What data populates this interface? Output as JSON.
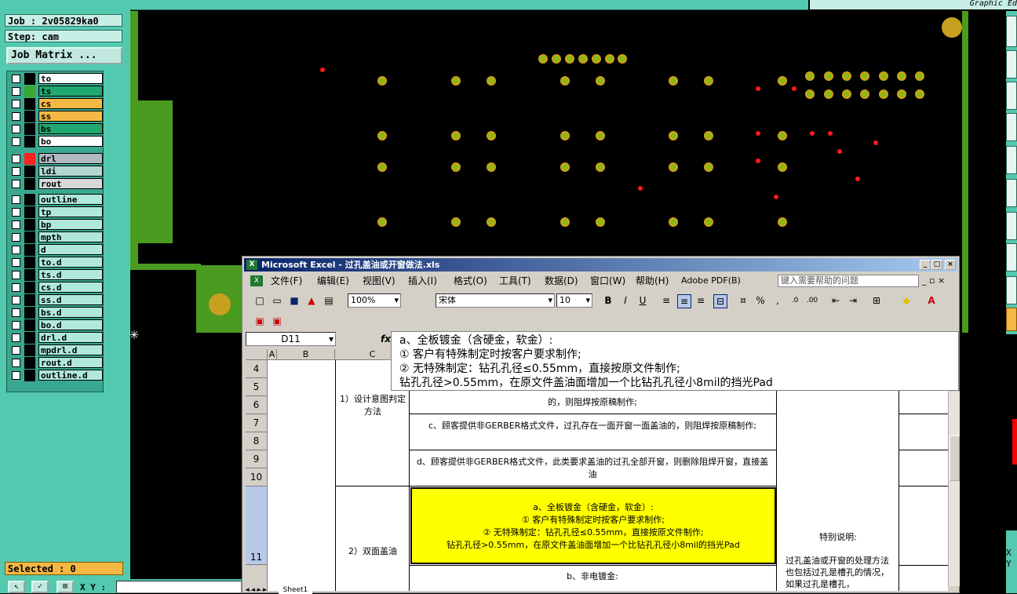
{
  "left_panel": {
    "job": "Job : 2v05829ka0",
    "step": "Step: cam",
    "job_matrix_button": "Job Matrix ...",
    "selected": "Selected : 0"
  },
  "layers": [
    {
      "name": "to",
      "color": "#ffffff",
      "swatch": "#000000"
    },
    {
      "name": "ts",
      "color": "#1fa870",
      "swatch": "#3aa830"
    },
    {
      "name": "cs",
      "color": "#f5b844",
      "swatch": "#000000"
    },
    {
      "name": "ss",
      "color": "#f5b844",
      "swatch": "#000000"
    },
    {
      "name": "bs",
      "color": "#1fa870",
      "swatch": "#000000"
    },
    {
      "name": "bo",
      "color": "#ffffff",
      "swatch": "#000000"
    },
    {
      "name": "drl",
      "color": "#b0b8c0",
      "swatch": "#ff2020"
    },
    {
      "name": "ldi",
      "color": "#b0d8d0",
      "swatch": "#000000"
    },
    {
      "name": "rout",
      "color": "#d8d8d8",
      "swatch": "#000000"
    },
    {
      "name": "outline",
      "color": "#b0e8dc",
      "swatch": "#000000"
    },
    {
      "name": "tp",
      "color": "#b0e8dc",
      "swatch": "#000000"
    },
    {
      "name": "bp",
      "color": "#b0e8dc",
      "swatch": "#000000"
    },
    {
      "name": "mpth",
      "color": "#b0e8dc",
      "swatch": "#000000"
    },
    {
      "name": "d",
      "color": "#b0e8dc",
      "swatch": "#000000"
    },
    {
      "name": "to.d",
      "color": "#b0e8dc",
      "swatch": "#000000"
    },
    {
      "name": "ts.d",
      "color": "#b0e8dc",
      "swatch": "#000000"
    },
    {
      "name": "cs.d",
      "color": "#b0e8dc",
      "swatch": "#000000"
    },
    {
      "name": "ss.d",
      "color": "#b0e8dc",
      "swatch": "#000000"
    },
    {
      "name": "bs.d",
      "color": "#b0e8dc",
      "swatch": "#000000"
    },
    {
      "name": "bo.d",
      "color": "#b0e8dc",
      "swatch": "#000000"
    },
    {
      "name": "drl.d",
      "color": "#b0e8dc",
      "swatch": "#000000"
    },
    {
      "name": "mpdrl.d",
      "color": "#b0e8dc",
      "swatch": "#000000"
    },
    {
      "name": "rout.d",
      "color": "#b0e8dc",
      "swatch": "#000000"
    },
    {
      "name": "outline.d",
      "color": "#b0e8dc",
      "swatch": "#000000"
    }
  ],
  "top_right_title": "Graphic Ed",
  "status_bar": {
    "xy_label": "X Y :",
    "right_x": "X",
    "right_y": "Y"
  },
  "excel": {
    "title": "Microsoft Excel - 过孔盖油或开窗做法.xls",
    "menu": [
      "文件(F)",
      "编辑(E)",
      "视图(V)",
      "插入(I)",
      "格式(O)",
      "工具(T)",
      "数据(D)",
      "窗口(W)",
      "帮助(H)",
      "Adobe PDF(B)"
    ],
    "help_placeholder": "键入需要帮助的问题",
    "zoom": "100%",
    "font": "宋体",
    "size": "10",
    "name_box": "D11",
    "fx": "fx",
    "formula_lines": [
      "a、全板镀金（含硬金，软金）:",
      "① 客户有特殊制定时按客户要求制作;",
      "② 无特殊制定：钻孔孔径≤0.55mm，直接按原文件制作;",
      "  钻孔孔径>0.55mm，在原文件盖油面增加一个比钻孔孔径小8mil的挡光Pad"
    ],
    "columns": [
      "A",
      "B",
      "C"
    ],
    "rows": [
      "4",
      "5",
      "6",
      "7",
      "8",
      "9",
      "10",
      "11"
    ],
    "cell_c_design": "1）设计意图判定方法",
    "cell_c_double": "2）双面盖油",
    "cell_d5": "的，则阻焊按原稿制作;",
    "cell_d7": "c、顾客提供非GERBER格式文件，过孔存在一面开窗一面盖油的，则阻焊按原稿制作;",
    "cell_d9": "d、顾客提供非GERBER格式文件，此类要求盖油的过孔全部开窗，则删除阻焊开窗，直接盖油",
    "cell_d11": [
      "a、全板镀金（含硬金，软金）:",
      "① 客户有特殊制定时按客户要求制作;",
      "② 无特殊制定：钻孔孔径≤0.55mm，直接按原文件制作;",
      "钻孔孔径>0.55mm，在原文件盖油面增加一个比钻孔孔径小8mil的挡光Pad"
    ],
    "cell_d12": "b、非电镀金:",
    "cell_e11": "特别说明:",
    "cell_e11b": "过孔盖油或开窗的处理方法也包括过孔是槽孔的情况，如果过孔是槽孔，",
    "sheet_tab": "Sheet1"
  }
}
